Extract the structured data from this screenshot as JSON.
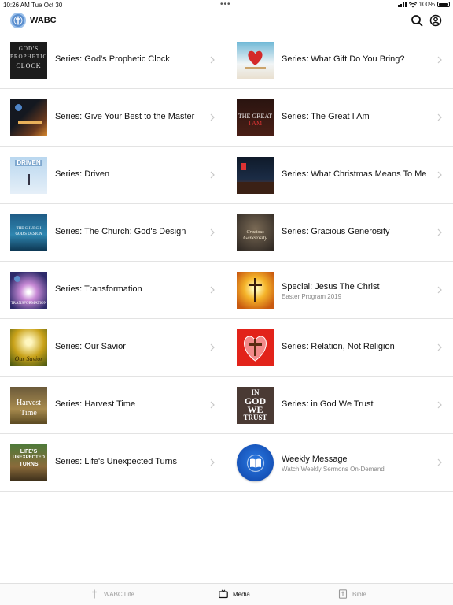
{
  "status_bar": {
    "time": "10:26 AM",
    "date": "Tue Oct 30",
    "battery": "100%"
  },
  "header": {
    "app_title": "WABC",
    "search_icon": "search-icon",
    "account_icon": "account-icon"
  },
  "items": [
    {
      "title": "Series:  God's Prophetic Clock",
      "subtitle": "",
      "thumb_text": "GOD PROPHETIC CLOCK"
    },
    {
      "title": "Series: What Gift Do You Bring?",
      "subtitle": "",
      "thumb_text": "GIFT"
    },
    {
      "title": "Series: Give Your Best to the Master",
      "subtitle": "",
      "thumb_text": ""
    },
    {
      "title": "Series: The Great I Am",
      "subtitle": "",
      "thumb_text": "THE GREAT I AM"
    },
    {
      "title": "Series:  Driven",
      "subtitle": "",
      "thumb_text": "DRIVEN"
    },
    {
      "title": "Series:  What Christmas Means To Me",
      "subtitle": "",
      "thumb_text": ""
    },
    {
      "title": "Series:  The Church:  God's Design",
      "subtitle": "",
      "thumb_text": "THE CHURCH GOD'S DESIGN"
    },
    {
      "title": "Series: Gracious Generosity",
      "subtitle": "",
      "thumb_text": "Gracious Generosity"
    },
    {
      "title": "Series: Transformation",
      "subtitle": "",
      "thumb_text": "TRANSFORMATION"
    },
    {
      "title": "Special: Jesus The Christ",
      "subtitle": "Easter Program 2019",
      "thumb_text": ""
    },
    {
      "title": "Series: Our Savior",
      "subtitle": "",
      "thumb_text": "Our Savior"
    },
    {
      "title": "Series:  Relation, Not Religion",
      "subtitle": "",
      "thumb_text": ""
    },
    {
      "title": "Series: Harvest Time",
      "subtitle": "",
      "thumb_text": "Harvest Time"
    },
    {
      "title": "Series: in God We Trust",
      "subtitle": "",
      "thumb_text": "IN GOD WE TRUST"
    },
    {
      "title": "Series: Life's Unexpected Turns",
      "subtitle": "",
      "thumb_text": "LIFE'S UNEXPECTED TURNS"
    },
    {
      "title": "Weekly Message",
      "subtitle": "Watch Weekly Sermons On-Demand",
      "thumb_text": ""
    }
  ],
  "tabbar": {
    "tabs": [
      {
        "label": "WABC Life",
        "icon": "cross-icon",
        "active": false
      },
      {
        "label": "Media",
        "icon": "tv-icon",
        "active": true
      },
      {
        "label": "Bible",
        "icon": "bible-icon",
        "active": false
      }
    ]
  },
  "colors": {
    "accent": "#1a5fd1",
    "divider": "#e3e3e3",
    "inactive": "#999999"
  }
}
